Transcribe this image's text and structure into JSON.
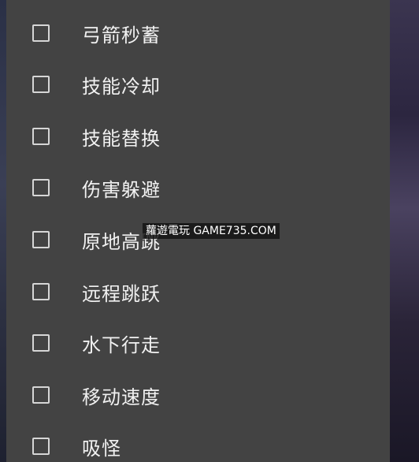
{
  "menu": {
    "items": [
      {
        "label": "弓箭秒蓄",
        "checked": false
      },
      {
        "label": "技能冷却",
        "checked": false
      },
      {
        "label": "技能替换",
        "checked": false
      },
      {
        "label": "伤害躲避",
        "checked": false
      },
      {
        "label": "原地高跳",
        "checked": false
      },
      {
        "label": "远程跳跃",
        "checked": false
      },
      {
        "label": "水下行走",
        "checked": false
      },
      {
        "label": "移动速度",
        "checked": false
      },
      {
        "label": "吸怪",
        "checked": false
      }
    ]
  },
  "watermark": {
    "text": "蘿遊電玩 GAME735.COM"
  },
  "colors": {
    "panel": "#434343",
    "text": "#f1f1f1",
    "checkbox_border": "#d6d6d6"
  }
}
